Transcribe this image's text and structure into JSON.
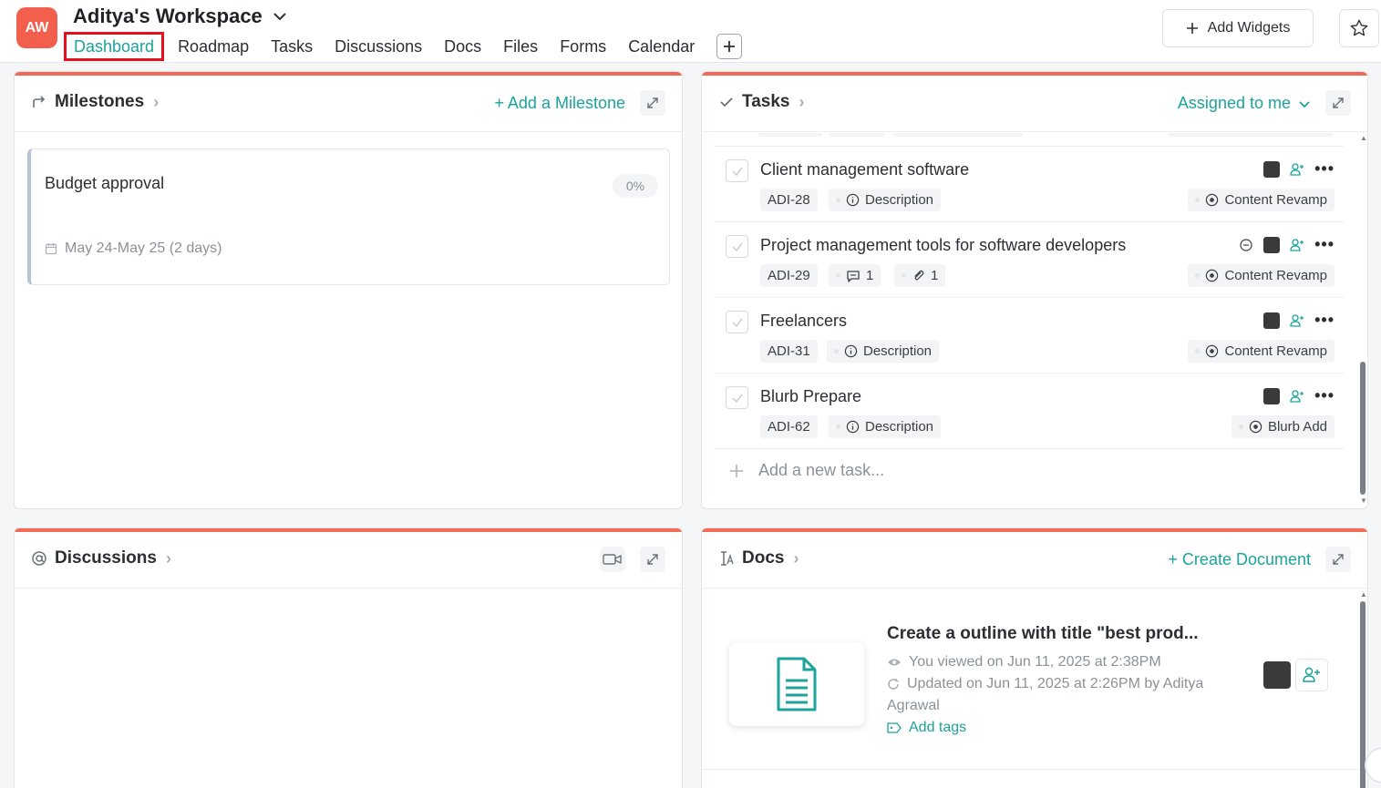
{
  "header": {
    "avatar_initials": "AW",
    "workspace_name": "Aditya's Workspace",
    "nav": [
      {
        "label": "Dashboard",
        "active": true
      },
      {
        "label": "Roadmap"
      },
      {
        "label": "Tasks"
      },
      {
        "label": "Discussions"
      },
      {
        "label": "Docs"
      },
      {
        "label": "Files"
      },
      {
        "label": "Forms"
      },
      {
        "label": "Calendar"
      }
    ],
    "add_widgets": "Add Widgets"
  },
  "milestones": {
    "title": "Milestones",
    "action": "+ Add a Milestone",
    "items": [
      {
        "name": "Budget approval",
        "progress": "0%",
        "dates": "May 24-May 25 (2 days)"
      }
    ]
  },
  "tasks": {
    "title": "Tasks",
    "filter": "Assigned to me",
    "items": [
      {
        "name": "Client management software",
        "id": "ADI-28",
        "chip": "Description",
        "tag": "Content Revamp"
      },
      {
        "name": "Project management tools for software developers",
        "id": "ADI-29",
        "comments": "1",
        "attachments": "1",
        "tag": "Content Revamp"
      },
      {
        "name": "Freelancers",
        "id": "ADI-31",
        "chip": "Description",
        "tag": "Content Revamp"
      },
      {
        "name": "Blurb Prepare",
        "id": "ADI-62",
        "chip": "Description",
        "tag": "Blurb Add"
      }
    ],
    "add_new": "Add a new task..."
  },
  "discussions": {
    "title": "Discussions"
  },
  "docs": {
    "title": "Docs",
    "action": "+ Create Document",
    "item": {
      "title": "Create a outline with title \"best prod...",
      "viewed": "You viewed on Jun 11, 2025 at 2:38PM",
      "updated": "Updated on Jun 11, 2025 at 2:26PM by Aditya",
      "updated_cont": "Agrawal",
      "add_tags": "Add tags"
    }
  },
  "colors": {
    "accent": "#1ba39c",
    "brand": "#f25f4c",
    "widget_top_bar": "#f26a55",
    "active_outline": "#e5101d"
  }
}
